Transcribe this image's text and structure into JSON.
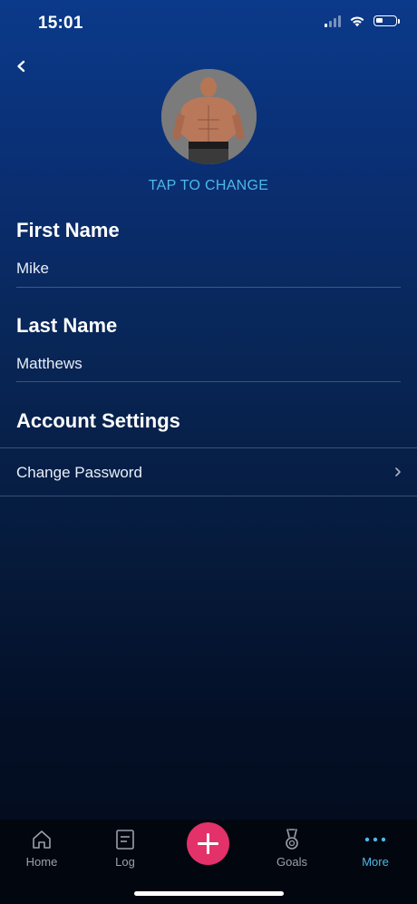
{
  "status_bar": {
    "time": "15:01",
    "battery_level": 0.35,
    "signal_bars_active": 1
  },
  "profile": {
    "tap_to_change": "TAP TO CHANGE",
    "first_name": {
      "label": "First Name",
      "value": "Mike"
    },
    "last_name": {
      "label": "Last Name",
      "value": "Matthews"
    }
  },
  "account_settings": {
    "heading": "Account Settings",
    "items": [
      {
        "label": "Change Password"
      }
    ]
  },
  "tabbar": {
    "items": [
      {
        "label": "Home",
        "icon": "home-icon"
      },
      {
        "label": "Log",
        "icon": "log-icon"
      },
      {
        "label": "Goals",
        "icon": "medal-icon"
      },
      {
        "label": "More",
        "icon": "more-icon",
        "active": true
      }
    ],
    "add_icon": "plus-icon"
  },
  "colors": {
    "accent": "#4fb8e8",
    "add_button": "#e3316a",
    "tab_inactive": "#9aa0ab"
  }
}
